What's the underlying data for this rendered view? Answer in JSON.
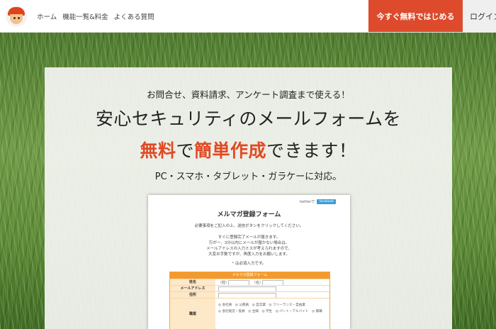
{
  "header": {
    "nav": [
      "ホーム",
      "機能一覧&料金",
      "よくある質問"
    ],
    "cta_label": "今すぐ無料ではじめる",
    "login_label": "ログイン"
  },
  "hero": {
    "subheading": "お問合せ、資料請求、アンケート調査まで使える！",
    "headline_line1": "安心セキュリティのメールフォームを",
    "headline_line2_parts": [
      "無料",
      "で",
      "簡単作成",
      "できます！"
    ],
    "compat": "PC・スマホ・タブレット・ガラケーに対応。",
    "highlight_color": "#e04a23"
  },
  "mockup": {
    "share_text": "twitterで",
    "share_button": "facebook",
    "title": "メルマガ登録フォーム",
    "intro_lines": [
      "必要事項をご記入の上、送信ボタンをクリックしてください。",
      "すぐに登録完了メールが届きます。",
      "万が一、3分以内にメールが届かない場合は、",
      "メールアドレスの入力ミスが考えられますので、",
      "大変お手数ですが、再度入力をお願いします。"
    ],
    "required_mark": "*",
    "required_note": "は必須入力です。",
    "form_head": "メルマガ登録フォーム",
    "rows": [
      {
        "label": "姓名",
        "fields": [
          "（姓）",
          "（名）"
        ]
      },
      {
        "label": "メールアドレス",
        "fields": []
      },
      {
        "label": "住所",
        "fields": []
      },
      {
        "label": "職業",
        "options_line1": "◎ 会社員　◎ 公務員　◎ 自営業　◎ フリーランス・自由業",
        "options_line2": "◎ 会社経営・役員　◎ 主婦　◎ 学生　◎ パート・アルバイト　◎ 無職"
      }
    ]
  },
  "colors": {
    "cta_bg": "#dd4a2c",
    "form_accent": "#f39a2e"
  }
}
